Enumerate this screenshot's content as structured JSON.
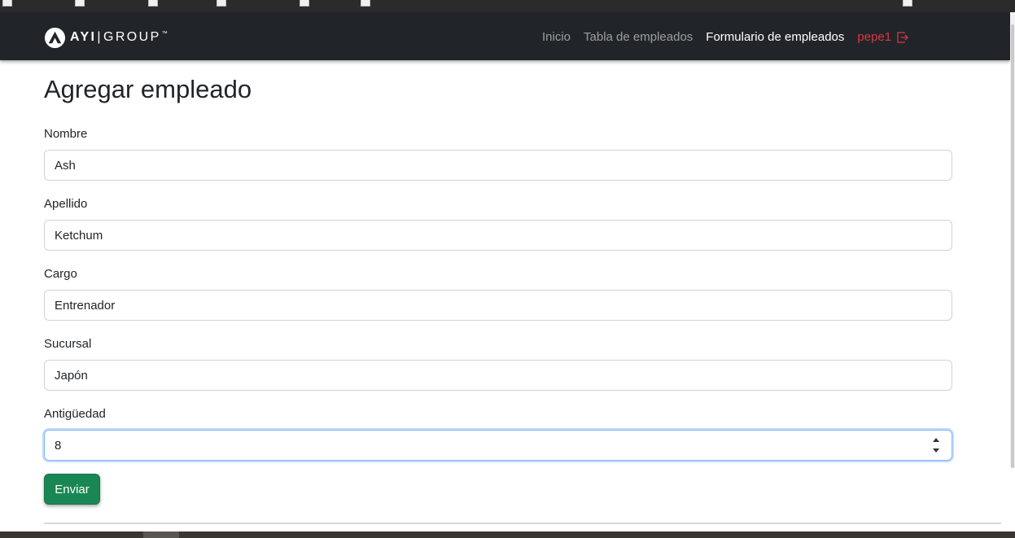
{
  "navbar": {
    "brand": {
      "ayi": "AYI",
      "separator": "|",
      "group": "GROUP",
      "tm": "™"
    },
    "links": [
      {
        "label": "Inicio",
        "active": false
      },
      {
        "label": "Tabla de empleados",
        "active": false
      },
      {
        "label": "Formulario de empleados",
        "active": true
      }
    ],
    "user": {
      "label": "pepe1",
      "icon": "logout-icon"
    }
  },
  "form": {
    "title": "Agregar empleado",
    "fields": [
      {
        "label": "Nombre",
        "value": "Ash",
        "type": "text"
      },
      {
        "label": "Apellido",
        "value": "Ketchum",
        "type": "text"
      },
      {
        "label": "Cargo",
        "value": "Entrenador",
        "type": "text"
      },
      {
        "label": "Sucursal",
        "value": "Japón",
        "type": "text"
      },
      {
        "label": "Antigüedad",
        "value": "8",
        "type": "number",
        "focused": true
      }
    ],
    "submit_label": "Enviar"
  },
  "colors": {
    "navbar_bg": "#212529",
    "user_link": "#dc3545",
    "submit_bg": "#198754",
    "focus_border": "#86b7fe"
  }
}
